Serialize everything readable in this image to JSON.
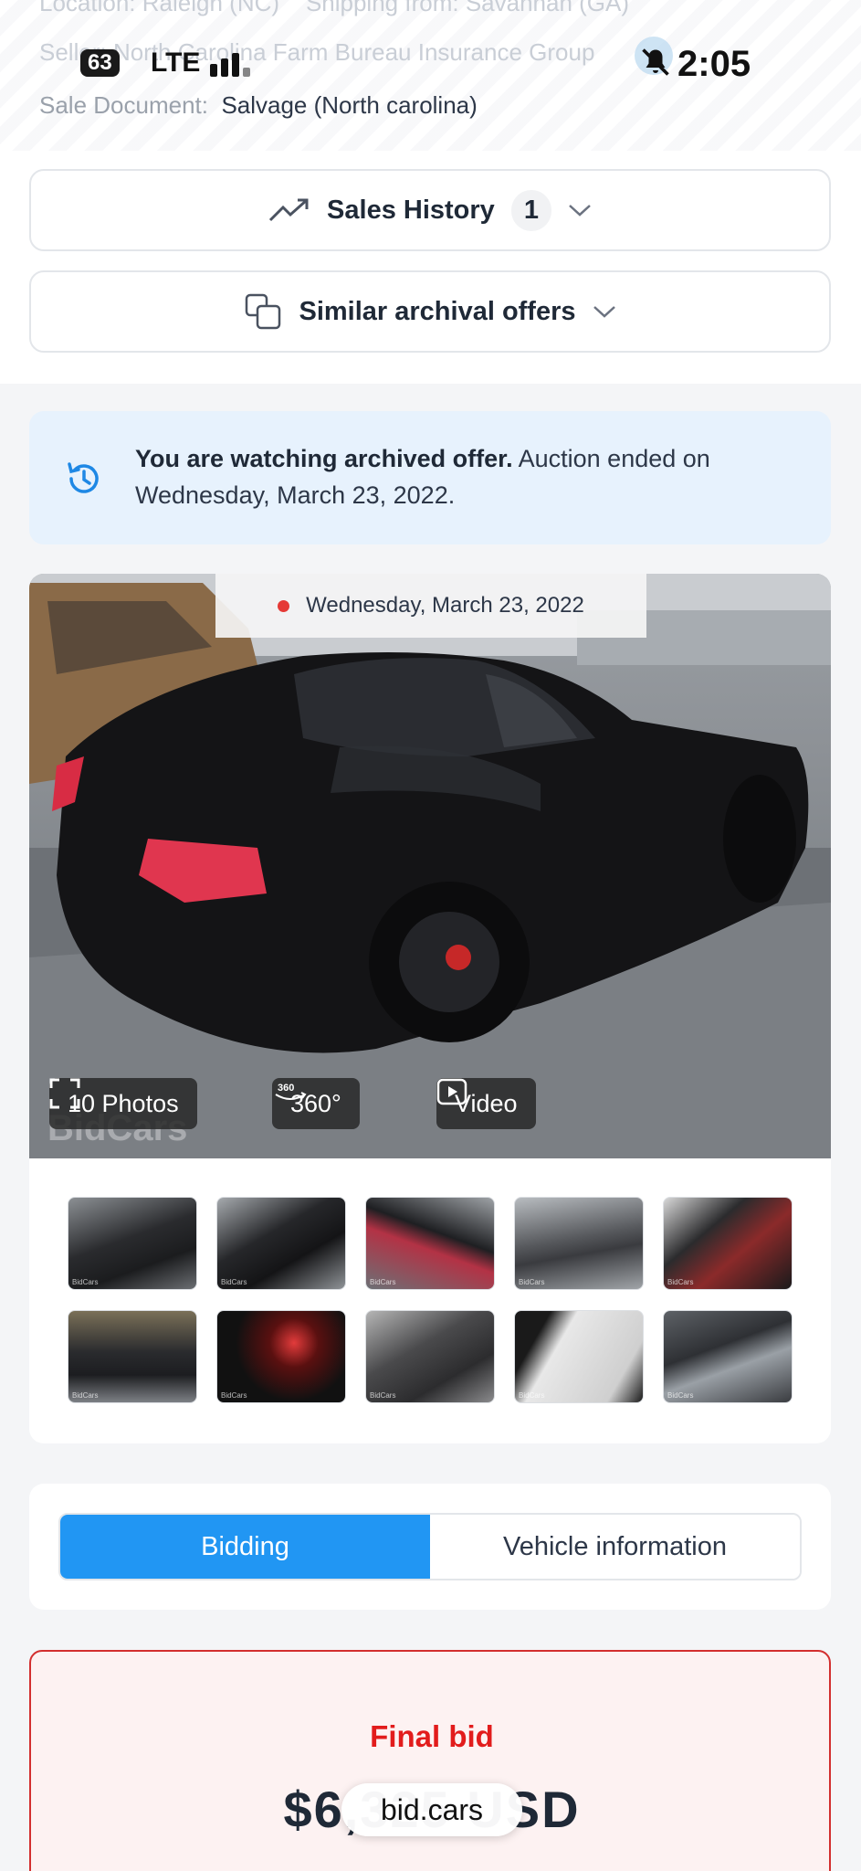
{
  "status_bar": {
    "signal": "63",
    "network": "LTE",
    "time": "2:05"
  },
  "lot_info": {
    "location_label": "Location:",
    "location_value": "Raleigh (NC)",
    "shipping_label": "Shipping from:",
    "shipping_value": "Savannah (GA)",
    "seller_label": "Seller:",
    "seller_value": "North Carolina Farm Bureau Insurance Group",
    "sale_doc_label": "Sale Document:",
    "sale_doc_value": "Salvage (North carolina)"
  },
  "sales_history": {
    "label": "Sales History",
    "count": "1"
  },
  "similar_offers": {
    "label": "Similar archival offers"
  },
  "archived_notice": {
    "bold": "You are watching archived offer.",
    "text": " Auction ended on Wednesday, March 23, 2022."
  },
  "gallery": {
    "date": "Wednesday, March 23, 2022",
    "photos_label": "10 Photos",
    "spin_label": "360°",
    "video_label": "Video",
    "watermark": "BidCars",
    "thumb_tag": "BidCars"
  },
  "tabs": {
    "bidding": "Bidding",
    "vehicle_info": "Vehicle information"
  },
  "final_bid": {
    "label": "Final bid",
    "amount": "$6,325 USD"
  },
  "browser": {
    "url": "bid.cars"
  },
  "colors": {
    "accent": "#2196f3",
    "final_red": "#e21c1c",
    "notice_bg": "#e7f2fd"
  }
}
